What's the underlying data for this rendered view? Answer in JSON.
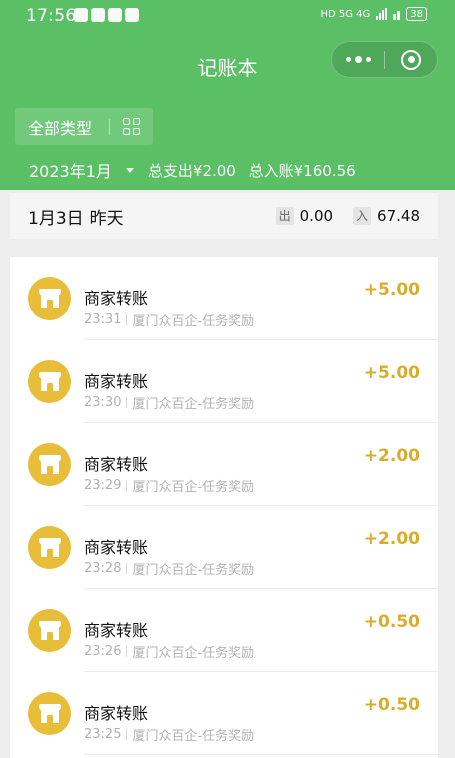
{
  "status_bar": {
    "time": "17:56",
    "indicators": "HD 5G 4G",
    "battery": "38"
  },
  "nav": {
    "title": "记账本"
  },
  "filter": {
    "label": "全部类型"
  },
  "summary": {
    "month": "2023年1月",
    "total_expense": "总支出¥2.00",
    "total_income": "总入账¥160.56"
  },
  "day": {
    "date": "1月3日",
    "relative": "昨天",
    "out_tag": "出",
    "out_value": "0.00",
    "in_tag": "入",
    "in_value": "67.48"
  },
  "transactions": [
    {
      "title": "商家转账",
      "time": "23:31",
      "source": "厦门众百企-任务奖励",
      "amount": "+5.00"
    },
    {
      "title": "商家转账",
      "time": "23:30",
      "source": "厦门众百企-任务奖励",
      "amount": "+5.00"
    },
    {
      "title": "商家转账",
      "time": "23:29",
      "source": "厦门众百企-任务奖励",
      "amount": "+2.00"
    },
    {
      "title": "商家转账",
      "time": "23:28",
      "source": "厦门众百企-任务奖励",
      "amount": "+2.00"
    },
    {
      "title": "商家转账",
      "time": "23:26",
      "source": "厦门众百企-任务奖励",
      "amount": "+0.50"
    },
    {
      "title": "商家转账",
      "time": "23:25",
      "source": "厦门众百企-任务奖励",
      "amount": "+0.50"
    }
  ],
  "icons": {
    "transaction": "shop-icon",
    "filter": "grid-icon",
    "more": "more-icon",
    "close": "close-circle-icon"
  },
  "colors": {
    "header_green": "#5bbf66",
    "amount_gold": "#d9ad2b",
    "icon_gold": "#e8bd3a"
  }
}
